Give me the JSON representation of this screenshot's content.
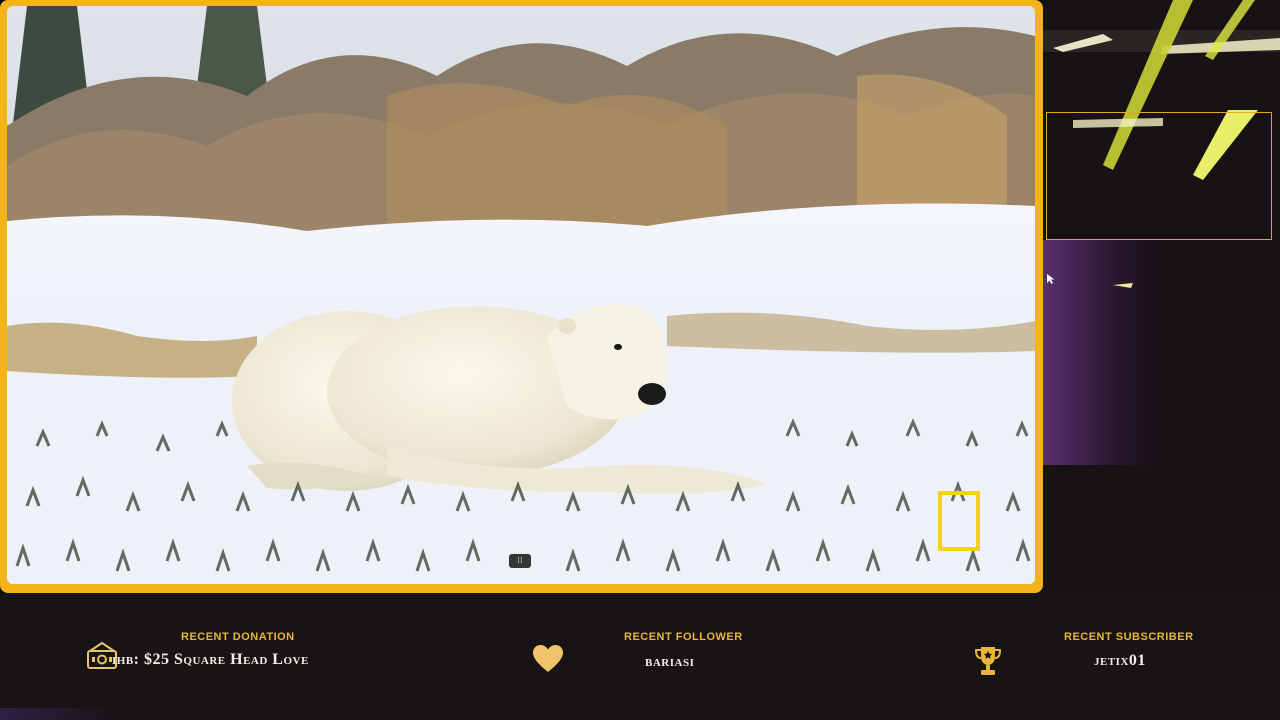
{
  "overlay": {
    "recent_donation": {
      "heading": "Recent Donation",
      "value": "ihb: $25  Square Head Love",
      "icon": "money-icon"
    },
    "recent_follower": {
      "heading": "Recent Follower",
      "value": "bariasi",
      "icon": "heart-icon"
    },
    "recent_subscriber": {
      "heading": "Recent Subscriber",
      "value": "jetix01",
      "icon": "trophy-icon"
    }
  },
  "video": {
    "subject": "polar-bear-scene",
    "logo": "nat-geo-logo",
    "handle_label": "⁞⁞"
  },
  "colors": {
    "frame_gold": "#f2b31b",
    "bar_background": "#181314",
    "heading_gold": "#e9b63a",
    "value_text": "#f3efe8"
  }
}
